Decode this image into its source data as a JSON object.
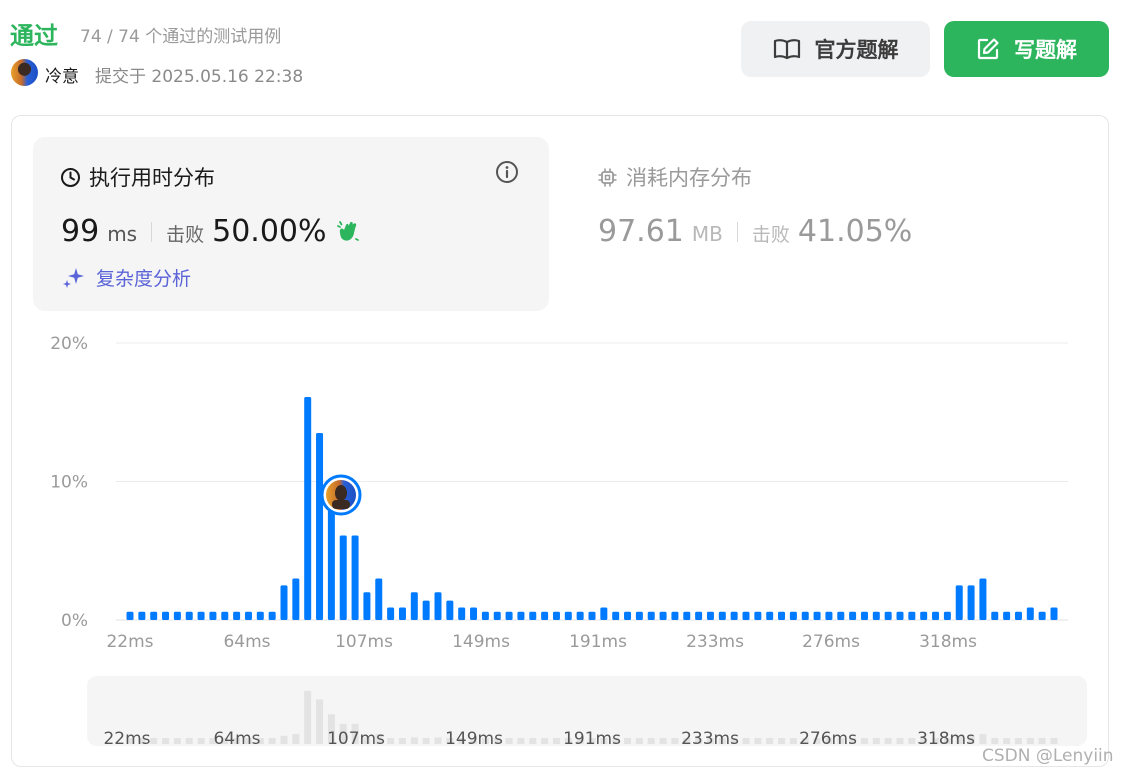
{
  "status": {
    "title": "通过",
    "count": "74 / 74 个通过的测试用例"
  },
  "submission": {
    "user": "冷意",
    "submitted": "提交于 2025.05.16 22:38"
  },
  "buttons": {
    "official": "官方题解",
    "write": "写题解"
  },
  "runtime": {
    "title": "执行用时分布",
    "value": "99",
    "unit": "ms",
    "beat_label": "击败",
    "beat_value": "50.00%",
    "complexity": "复杂度分析"
  },
  "memory": {
    "title": "消耗内存分布",
    "value": "97.61",
    "unit": "MB",
    "beat_label": "击败",
    "beat_value": "41.05%"
  },
  "colors": {
    "accent_green": "#2db55d",
    "bar_blue": "#007aff",
    "complexity_purple": "#5a63d8"
  },
  "watermark": "CSDN @Lenyiin",
  "chart_data": {
    "type": "bar",
    "y_ticks": [
      "20%",
      "10%",
      "0%"
    ],
    "ylim": [
      0,
      20
    ],
    "x_tick_labels": [
      "22ms",
      "64ms",
      "107ms",
      "149ms",
      "191ms",
      "233ms",
      "276ms",
      "318ms"
    ],
    "highlight_label": "99ms",
    "values": [
      0.6,
      0.6,
      0.6,
      0.6,
      0.6,
      0.6,
      0.6,
      0.6,
      0.6,
      0.6,
      0.6,
      0.6,
      0.6,
      2.5,
      3.0,
      16.1,
      13.5,
      9.0,
      6.1,
      6.1,
      2.0,
      3.0,
      0.9,
      0.9,
      2.0,
      1.4,
      2.0,
      1.4,
      0.9,
      0.9,
      0.6,
      0.6,
      0.6,
      0.6,
      0.6,
      0.6,
      0.6,
      0.6,
      0.6,
      0.6,
      0.9,
      0.6,
      0.6,
      0.6,
      0.6,
      0.6,
      0.6,
      0.6,
      0.6,
      0.6,
      0.6,
      0.6,
      0.6,
      0.6,
      0.6,
      0.6,
      0.6,
      0.6,
      0.6,
      0.6,
      0.6,
      0.6,
      0.6,
      0.6,
      0.6,
      0.6,
      0.6,
      0.6,
      0.6,
      0.6,
      2.5,
      2.5,
      3.0,
      0.6,
      0.6,
      0.6,
      0.9,
      0.6,
      0.9
    ]
  }
}
